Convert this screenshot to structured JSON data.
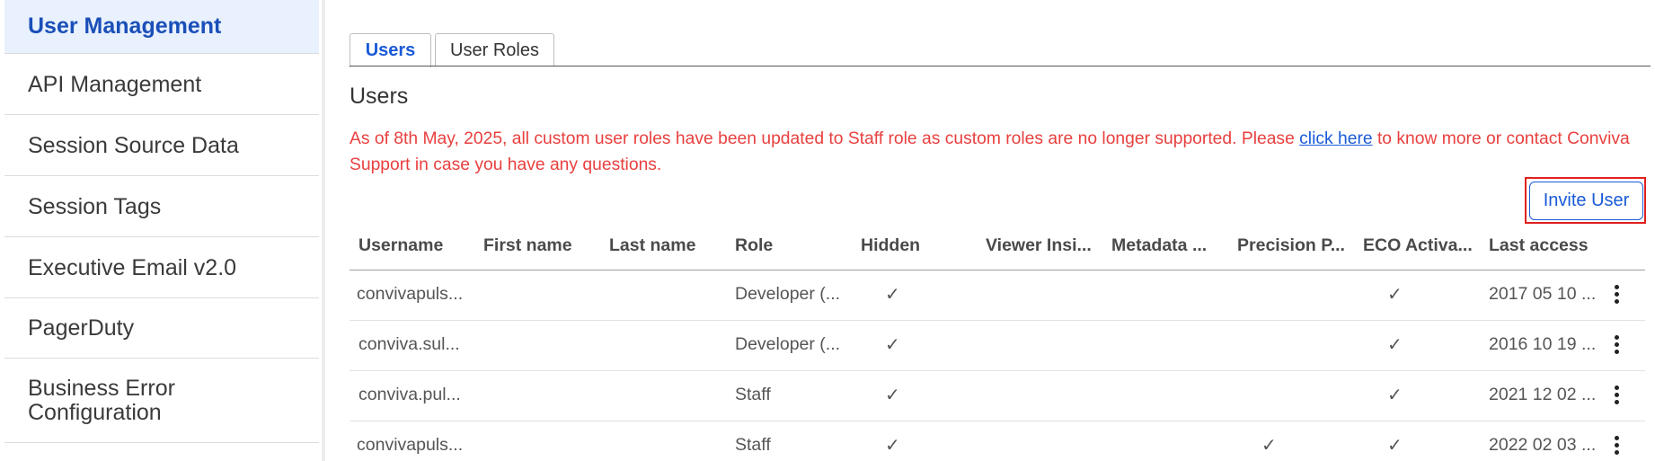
{
  "sidebar": {
    "items": [
      {
        "label": "User Management",
        "active": true
      },
      {
        "label": "API Management"
      },
      {
        "label": "Session Source Data"
      },
      {
        "label": "Session Tags"
      },
      {
        "label": "Executive Email v2.0"
      },
      {
        "label": "PagerDuty"
      },
      {
        "label": "Business Error Configuration"
      }
    ]
  },
  "tabs": [
    {
      "label": "Users",
      "active": true
    },
    {
      "label": "User Roles"
    }
  ],
  "page": {
    "title": "Users",
    "notice_prefix": "As of 8th May, 2025, all custom user roles have been updated to Staff role as custom roles are no longer supported. Please ",
    "notice_link": "click here",
    "notice_suffix": " to know more or contact Conviva Support in case you have any questions.",
    "invite_label": "Invite User"
  },
  "table": {
    "columns": [
      "Username",
      "First name",
      "Last name",
      "Role",
      "Hidden",
      "Viewer Insi...",
      "Metadata ...",
      "Precision P...",
      "ECO Activa...",
      "Last access"
    ],
    "check_glyph": "✓",
    "rows": [
      {
        "username": "convivapuls...",
        "first": "",
        "last": "",
        "role": "Developer (...",
        "hidden": true,
        "viewer": false,
        "metadata": false,
        "precision": false,
        "eco": true,
        "last_access": "2017 05 10 ..."
      },
      {
        "username": "conviva.sul...",
        "first": "",
        "last": "",
        "role": "Developer (...",
        "hidden": true,
        "viewer": false,
        "metadata": false,
        "precision": false,
        "eco": true,
        "last_access": "2016 10 19 ..."
      },
      {
        "username": "conviva.pul...",
        "first": "",
        "last": "",
        "role": "Staff",
        "hidden": true,
        "viewer": false,
        "metadata": false,
        "precision": false,
        "eco": true,
        "last_access": "2021 12 02 ..."
      },
      {
        "username": "convivapuls...",
        "first": "",
        "last": "",
        "role": "Staff",
        "hidden": true,
        "viewer": false,
        "metadata": false,
        "precision": true,
        "eco": true,
        "last_access": "2022 02 03 ..."
      }
    ]
  },
  "colors": {
    "accent": "#1a5ad7",
    "notice": "#e8403f",
    "highlight": "#e02020",
    "active_bg": "#e8f1fd"
  }
}
